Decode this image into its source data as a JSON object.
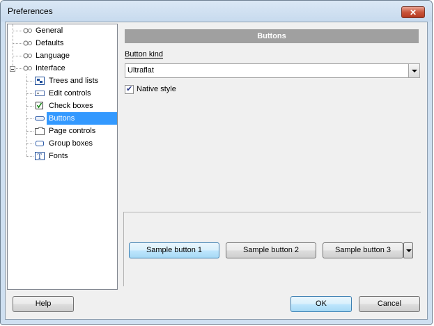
{
  "window": {
    "title": "Preferences"
  },
  "tree": {
    "items": [
      {
        "label": "General",
        "icon": "settings-icon"
      },
      {
        "label": "Defaults",
        "icon": "settings-icon"
      },
      {
        "label": "Language",
        "icon": "settings-icon"
      },
      {
        "label": "Interface",
        "icon": "settings-icon"
      },
      {
        "label": "Trees and lists",
        "icon": "tree-list-icon"
      },
      {
        "label": "Edit controls",
        "icon": "edit-control-icon"
      },
      {
        "label": "Check boxes",
        "icon": "checkbox-icon"
      },
      {
        "label": "Buttons",
        "icon": "button-icon",
        "selected": true
      },
      {
        "label": "Page controls",
        "icon": "folder-tab-icon"
      },
      {
        "label": "Group boxes",
        "icon": "group-box-icon"
      },
      {
        "label": "Fonts",
        "icon": "font-icon"
      }
    ]
  },
  "panel": {
    "header": "Buttons",
    "button_kind_label": "Button kind",
    "button_kind_value": "Ultraflat",
    "native_style_label": "Native style",
    "native_style_checked": true
  },
  "samples": {
    "button1": "Sample button 1",
    "button2": "Sample button 2",
    "button3": "Sample button 3"
  },
  "footer": {
    "help": "Help",
    "ok": "OK",
    "cancel": "Cancel"
  },
  "colors": {
    "selection": "#3399ff",
    "header_bg": "#a0a0a0",
    "close_button": "#c9553b"
  }
}
